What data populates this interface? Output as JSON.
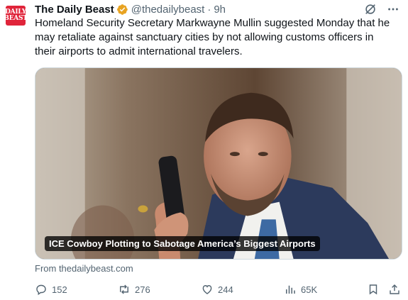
{
  "tweet": {
    "avatar_line1": "DAILY",
    "avatar_line2": "BEAST",
    "author_name": "The Daily Beast",
    "handle": "@thedailybeast",
    "separator": "·",
    "time": "9h",
    "text": "Homeland Security Secretary Markwayne Mullin suggested Monday that he may retaliate against sanctuary cities by not allowing customs officers in their airports to admit international travelers.",
    "card": {
      "caption": "ICE Cowboy Plotting to Sabotage America’s Biggest Airports",
      "source": "From thedailybeast.com"
    },
    "stats": {
      "replies": "152",
      "reposts": "276",
      "likes": "244",
      "views": "65K"
    }
  },
  "colors": {
    "verified_badge": "#e8a321",
    "avatar_bg": "#e0243a",
    "muted_text": "#536471"
  },
  "icons": [
    "verified-badge-icon",
    "grok-icon",
    "more-icon",
    "reply-icon",
    "repost-icon",
    "like-icon",
    "views-icon",
    "bookmark-icon",
    "share-icon"
  ]
}
